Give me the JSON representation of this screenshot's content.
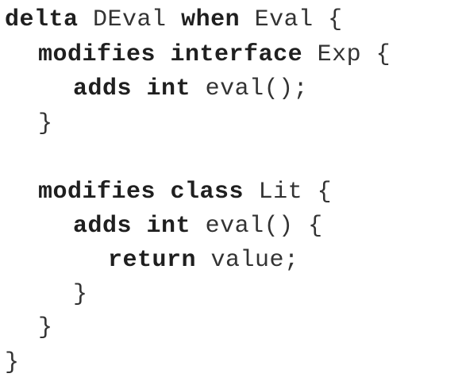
{
  "code": {
    "lines": [
      {
        "indent": 0,
        "tokens": [
          {
            "text": "delta",
            "type": "kw"
          },
          {
            "text": " ",
            "type": "sp"
          },
          {
            "text": "DEval",
            "type": "id"
          },
          {
            "text": " ",
            "type": "sp"
          },
          {
            "text": "when",
            "type": "kw"
          },
          {
            "text": " ",
            "type": "sp"
          },
          {
            "text": "Eval",
            "type": "id"
          },
          {
            "text": " ",
            "type": "sp"
          },
          {
            "text": "{",
            "type": "pn"
          }
        ]
      },
      {
        "indent": 1,
        "tokens": [
          {
            "text": "modifies",
            "type": "kw"
          },
          {
            "text": " ",
            "type": "sp"
          },
          {
            "text": "interface",
            "type": "kw"
          },
          {
            "text": " ",
            "type": "sp"
          },
          {
            "text": "Exp",
            "type": "id"
          },
          {
            "text": " ",
            "type": "sp"
          },
          {
            "text": "{",
            "type": "pn"
          }
        ]
      },
      {
        "indent": 2,
        "tokens": [
          {
            "text": "adds",
            "type": "kw"
          },
          {
            "text": " ",
            "type": "sp"
          },
          {
            "text": "int",
            "type": "kw"
          },
          {
            "text": " ",
            "type": "sp"
          },
          {
            "text": "eval();",
            "type": "id"
          }
        ]
      },
      {
        "indent": 1,
        "tokens": [
          {
            "text": "}",
            "type": "pn"
          }
        ]
      },
      {
        "indent": 0,
        "tokens": []
      },
      {
        "indent": 1,
        "tokens": [
          {
            "text": "modifies",
            "type": "kw"
          },
          {
            "text": " ",
            "type": "sp"
          },
          {
            "text": "class",
            "type": "kw"
          },
          {
            "text": " ",
            "type": "sp"
          },
          {
            "text": "Lit",
            "type": "id"
          },
          {
            "text": " ",
            "type": "sp"
          },
          {
            "text": "{",
            "type": "pn"
          }
        ]
      },
      {
        "indent": 2,
        "tokens": [
          {
            "text": "adds",
            "type": "kw"
          },
          {
            "text": " ",
            "type": "sp"
          },
          {
            "text": "int",
            "type": "kw"
          },
          {
            "text": " ",
            "type": "sp"
          },
          {
            "text": "eval()",
            "type": "id"
          },
          {
            "text": " ",
            "type": "sp"
          },
          {
            "text": "{",
            "type": "pn"
          }
        ]
      },
      {
        "indent": 3,
        "tokens": [
          {
            "text": "return",
            "type": "kw"
          },
          {
            "text": " ",
            "type": "sp"
          },
          {
            "text": "value;",
            "type": "id"
          }
        ]
      },
      {
        "indent": 2,
        "tokens": [
          {
            "text": "}",
            "type": "pn"
          }
        ]
      },
      {
        "indent": 1,
        "tokens": [
          {
            "text": "}",
            "type": "pn"
          }
        ]
      },
      {
        "indent": 0,
        "tokens": [
          {
            "text": "}",
            "type": "pn"
          }
        ]
      }
    ]
  }
}
